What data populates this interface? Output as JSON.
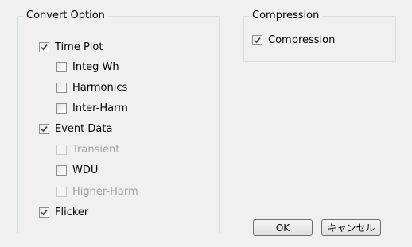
{
  "convert_group": {
    "title": "Convert Option",
    "items": [
      {
        "label": "Time Plot",
        "checked": true,
        "enabled": true
      },
      {
        "label": "Integ Wh",
        "checked": false,
        "enabled": true
      },
      {
        "label": "Harmonics",
        "checked": false,
        "enabled": true
      },
      {
        "label": "Inter-Harm",
        "checked": false,
        "enabled": true
      },
      {
        "label": "Event Data",
        "checked": true,
        "enabled": true
      },
      {
        "label": "Transient",
        "checked": false,
        "enabled": false
      },
      {
        "label": "WDU",
        "checked": false,
        "enabled": true
      },
      {
        "label": "Higher-Harm",
        "checked": false,
        "enabled": false
      },
      {
        "label": "Flicker",
        "checked": true,
        "enabled": true
      }
    ]
  },
  "compression_group": {
    "title": "Compression",
    "items": [
      {
        "label": "Compression",
        "checked": true,
        "enabled": true
      }
    ]
  },
  "buttons": {
    "ok_label": "OK",
    "cancel_label": "キャンセル"
  },
  "colors": {
    "check_mark": "#4a4a4a",
    "disabled_text": "#a0a0a0",
    "group_border": "#d5dfe5",
    "background": "#f0f0f0"
  }
}
